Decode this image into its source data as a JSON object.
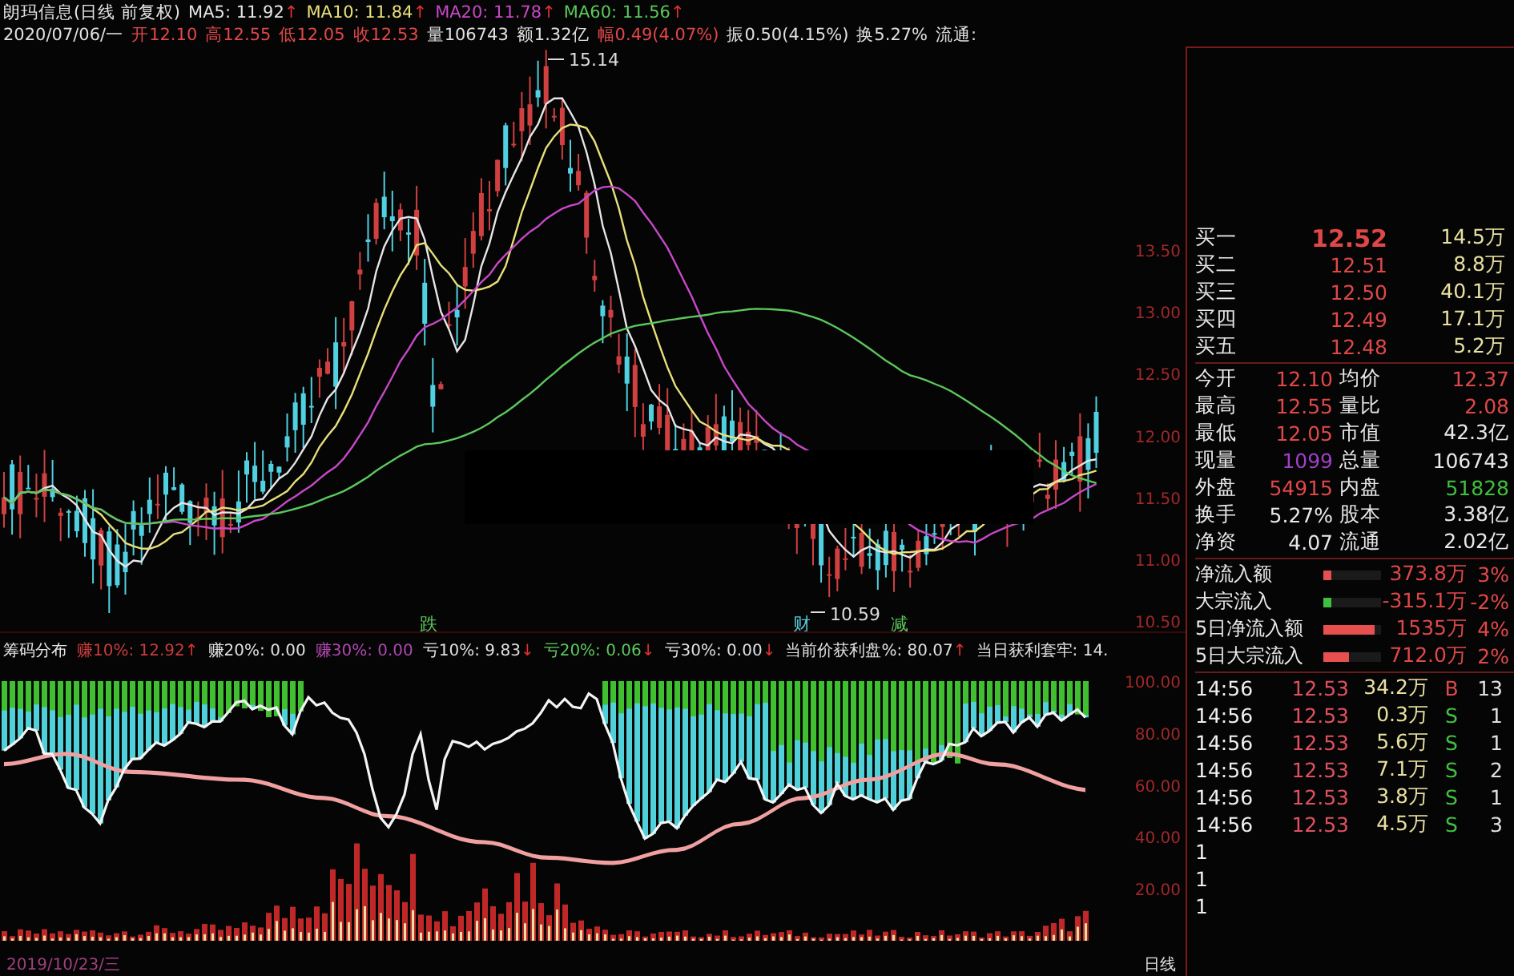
{
  "header": {
    "title": "朗玛信息(日线 前复权)",
    "ma": [
      {
        "label": "MA5: 11.92",
        "arrow": "↑",
        "color": "#e6e6e6"
      },
      {
        "label": "MA10: 11.84",
        "arrow": "↑",
        "color": "#e8e07a"
      },
      {
        "label": "MA20: 11.78",
        "arrow": "↑",
        "color": "#c848c8"
      },
      {
        "label": "MA60: 11.56",
        "arrow": "↑",
        "color": "#5cc85c"
      }
    ],
    "quote": [
      {
        "text": "2020/07/06/一",
        "color": "#e0e0e0"
      },
      {
        "text": "开12.10",
        "color": "#e04848"
      },
      {
        "text": "高12.55",
        "color": "#e04848"
      },
      {
        "text": "低12.05",
        "color": "#e04848"
      },
      {
        "text": "收12.53",
        "color": "#e04848"
      },
      {
        "text": "量106743",
        "color": "#e0e0e0"
      },
      {
        "text": "额1.32亿",
        "color": "#e0e0e0"
      },
      {
        "text": "幅0.49(4.07%)",
        "color": "#e04848"
      },
      {
        "text": "振0.50(4.15%)",
        "color": "#e0e0e0"
      },
      {
        "text": "换5.27%",
        "color": "#e0e0e0"
      },
      {
        "text": "流通:",
        "color": "#e0e0e0"
      }
    ]
  },
  "price_chart": {
    "axis_labels": [
      "13.50",
      "13.00",
      "12.50",
      "12.00",
      "11.50",
      "11.00",
      "10.50"
    ],
    "high_label": "15.14",
    "low_label": "10.59",
    "markers": [
      {
        "text": "跌",
        "color": "#5cc85c"
      },
      {
        "text": "财",
        "color": "#5ac8d8"
      },
      {
        "text": "减",
        "color": "#5cc85c"
      }
    ]
  },
  "chip_panel": {
    "title": "筹码分布",
    "stats": [
      {
        "text": "赚10%: 12.92",
        "arrow": "↑",
        "color": "#c83c3c"
      },
      {
        "text": "赚20%: 0.00",
        "color": "#e0e0e0"
      },
      {
        "text": "赚30%: 0.00",
        "color": "#b048b0"
      },
      {
        "text": "亏10%: 9.83",
        "arrow": "↓",
        "color": "#e0e0e0"
      },
      {
        "text": "亏20%: 0.06",
        "arrow": "↓",
        "color": "#5cc85c"
      },
      {
        "text": "亏30%: 0.00",
        "arrow": "↓",
        "color": "#e0e0e0"
      },
      {
        "text": "当前价获利盘%: 80.07",
        "arrow": "↑",
        "color": "#e0e0e0"
      },
      {
        "text": "当日获利套牢: 14.",
        "color": "#e0e0e0"
      }
    ],
    "axis_labels": [
      "100.00",
      "80.00",
      "60.00",
      "40.00",
      "20.00"
    ]
  },
  "date_axis": {
    "start_date": "2019/10/23/三",
    "period": "日线"
  },
  "order_book": [
    {
      "label": "买一",
      "price": "12.52",
      "volume": "14.5万",
      "selected": true
    },
    {
      "label": "买二",
      "price": "12.51",
      "volume": "8.8万",
      "selected": false
    },
    {
      "label": "买三",
      "price": "12.50",
      "volume": "40.1万",
      "selected": false
    },
    {
      "label": "买四",
      "price": "12.49",
      "volume": "17.1万",
      "selected": false
    },
    {
      "label": "买五",
      "price": "12.48",
      "volume": "5.2万",
      "selected": false
    }
  ],
  "stats": [
    [
      {
        "label": "今开",
        "value": "12.10",
        "color": "#e04848"
      },
      {
        "label": "均价",
        "value": "12.37",
        "color": "#e04848"
      }
    ],
    [
      {
        "label": "最高",
        "value": "12.55",
        "color": "#e04848"
      },
      {
        "label": "量比",
        "value": "2.08",
        "color": "#e04848"
      }
    ],
    [
      {
        "label": "最低",
        "value": "12.05",
        "color": "#e04848"
      },
      {
        "label": "市值",
        "value": "42.3亿",
        "color": "#e8e8e8"
      }
    ],
    [
      {
        "label": "现量",
        "value": "1099",
        "color": "#a040c8"
      },
      {
        "label": "总量",
        "value": "106743",
        "color": "#e8e8e8"
      }
    ],
    [
      {
        "label": "外盘",
        "value": "54915",
        "color": "#e04848"
      },
      {
        "label": "内盘",
        "value": "51828",
        "color": "#40c040"
      }
    ],
    [
      {
        "label": "换手",
        "value": "5.27%",
        "color": "#e8e8e8"
      },
      {
        "label": "股本",
        "value": "3.38亿",
        "color": "#e8e8e8"
      }
    ],
    [
      {
        "label": "净资",
        "value": "4.07",
        "color": "#e8e8e8"
      },
      {
        "label": "流通",
        "value": "2.02亿",
        "color": "#e8e8e8"
      }
    ]
  ],
  "flows": [
    {
      "label": "净流入额",
      "level": 0.15,
      "color": "#e85050",
      "amount": "373.8万",
      "percent": "3%"
    },
    {
      "label": "大宗流入",
      "level": 0.15,
      "color": "#40c040",
      "amount": "-315.1万",
      "percent": "-2%"
    },
    {
      "label": "5日净流入额",
      "level": 0.9,
      "color": "#e85050",
      "amount": "1535万",
      "percent": "4%"
    },
    {
      "label": "5日大宗流入",
      "level": 0.45,
      "color": "#e85050",
      "amount": "712.0万",
      "percent": "2%"
    }
  ],
  "trades": [
    {
      "time": "14:56",
      "price": "12.53",
      "volume": "34.2万",
      "side": "B",
      "kind": "buy",
      "count": "13"
    },
    {
      "time": "14:56",
      "price": "12.53",
      "volume": "0.3万",
      "side": "S",
      "kind": "sell",
      "count": "1"
    },
    {
      "time": "14:56",
      "price": "12.53",
      "volume": "5.6万",
      "side": "S",
      "kind": "sell",
      "count": "1"
    },
    {
      "time": "14:56",
      "price": "12.53",
      "volume": "7.1万",
      "side": "S",
      "kind": "sell",
      "count": "2"
    },
    {
      "time": "14:56",
      "price": "12.53",
      "volume": "3.8万",
      "side": "S",
      "kind": "sell",
      "count": "1"
    },
    {
      "time": "14:56",
      "price": "12.53",
      "volume": "4.5万",
      "side": "S",
      "kind": "sell",
      "count": "3"
    }
  ],
  "partial_trades": [
    "1",
    "1",
    "1"
  ]
}
